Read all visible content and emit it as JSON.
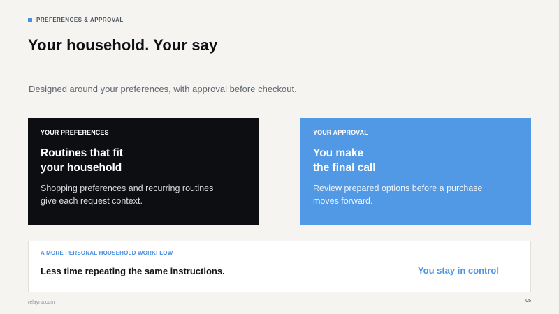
{
  "eyebrow": {
    "text": "PREFERENCES & APPROVAL",
    "accent_color": "#4a90e2"
  },
  "title": "Your household. Your say",
  "subtitle": "Designed around your preferences, with approval before checkout.",
  "cards": [
    {
      "label": "YOUR PREFERENCES",
      "heading_line_1": "Routines that fit",
      "heading_line_2": "your household",
      "body_line_1": "Shopping preferences and recurring routines",
      "body_line_2": "give each request context.",
      "background_color": "#0d0e12"
    },
    {
      "label": "YOUR APPROVAL",
      "heading_line_1": "You make",
      "heading_line_2": "the final call",
      "body_line_1": "Review prepared options before a purchase",
      "body_line_2": "moves forward.",
      "background_color": "#5199e5"
    }
  ],
  "strip": {
    "label": "A MORE PERSONAL HOUSEHOLD WORKFLOW",
    "left_text": "Less time repeating the same instructions.",
    "right_text": "You stay in control",
    "accent_color": "#4d95e3"
  },
  "footer": {
    "left": "relayna.com",
    "right": "05"
  }
}
